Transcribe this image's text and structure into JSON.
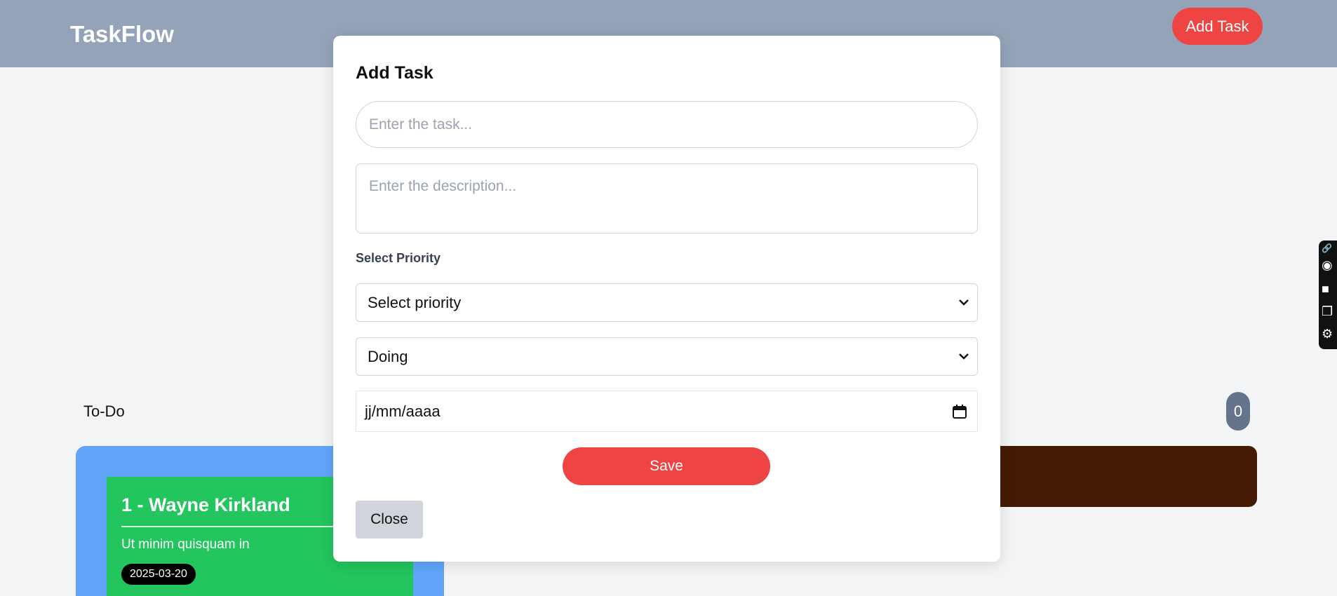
{
  "navbar": {
    "brand": "TaskFlow",
    "add_label": "Add Task"
  },
  "board": {
    "todo_label": "To-Do",
    "count": "0",
    "card": {
      "title": "1 - Wayne Kirkland",
      "description": "Ut minim quisquam in",
      "date": "2025-03-20"
    }
  },
  "modal": {
    "title": "Add Task",
    "task_placeholder": "Enter the task...",
    "description_placeholder": "Enter the description...",
    "priority_label": "Select Priority",
    "priority_selected": "Select priority",
    "status_selected": "Doing",
    "date_placeholder": "jj/mm/aaaa",
    "save_label": "Save",
    "close_label": "Close"
  },
  "colors": {
    "navbar": "#94a3b8",
    "accent": "#ef4444",
    "column_blue": "#60a5fa",
    "column_brown": "#451a03",
    "card_green": "#22c55e",
    "badge": "#64748b"
  },
  "side_widget": {
    "icons": [
      "link-icon",
      "camera-icon",
      "video-icon",
      "window-icon",
      "gear-icon"
    ]
  }
}
